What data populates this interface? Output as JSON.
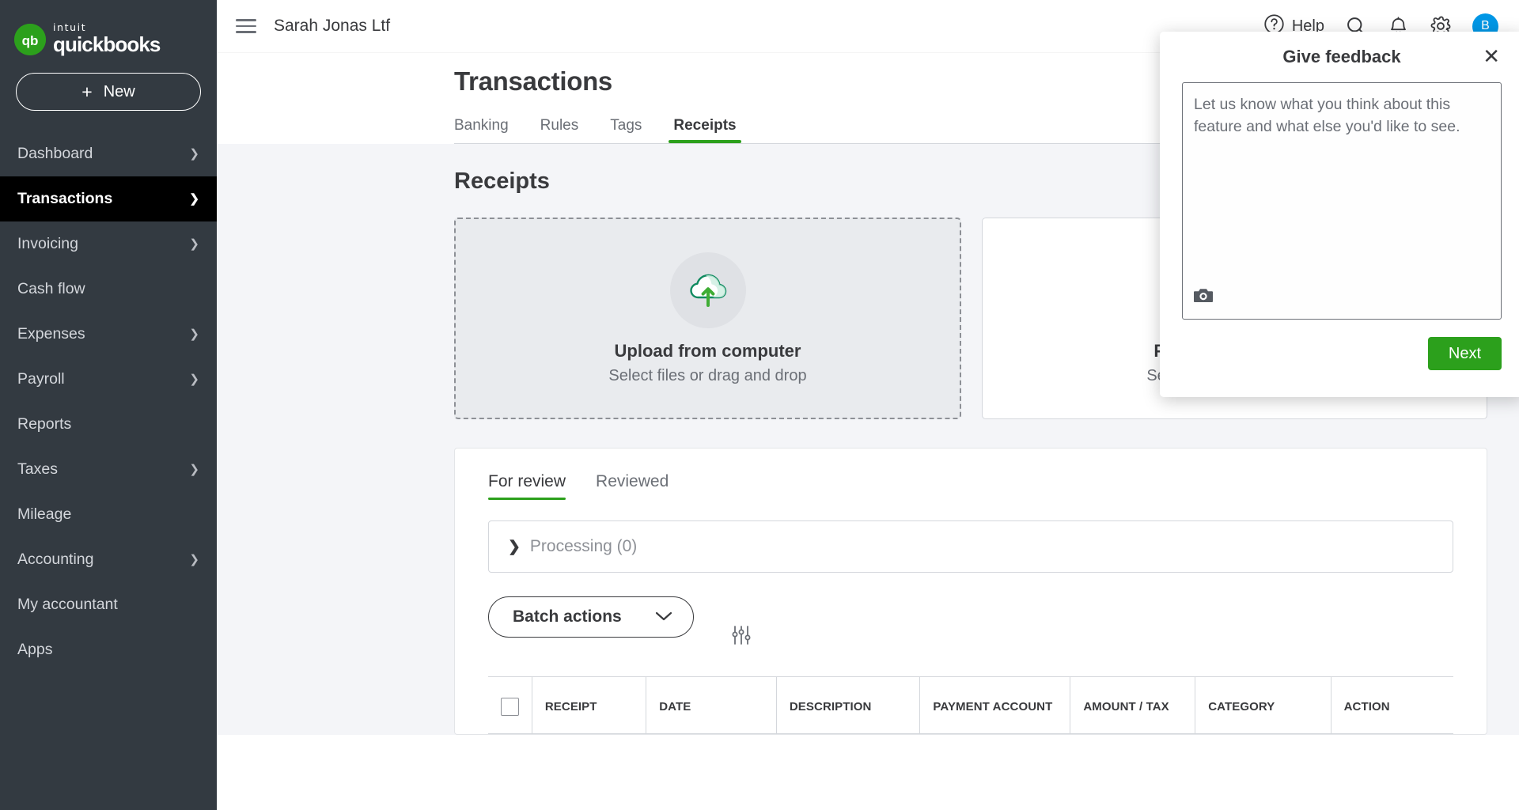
{
  "brand": {
    "intuit": "intuit",
    "product": "quickbooks",
    "mark_letters": "qb"
  },
  "sidebar": {
    "new_button": {
      "plus": "+",
      "label": "New"
    },
    "items": [
      {
        "label": "Dashboard",
        "has_chevron": true,
        "active": false
      },
      {
        "label": "Transactions",
        "has_chevron": true,
        "active": true
      },
      {
        "label": "Invoicing",
        "has_chevron": true,
        "active": false
      },
      {
        "label": "Cash flow",
        "has_chevron": false,
        "active": false
      },
      {
        "label": "Expenses",
        "has_chevron": true,
        "active": false
      },
      {
        "label": "Payroll",
        "has_chevron": true,
        "active": false
      },
      {
        "label": "Reports",
        "has_chevron": false,
        "active": false
      },
      {
        "label": "Taxes",
        "has_chevron": true,
        "active": false
      },
      {
        "label": "Mileage",
        "has_chevron": false,
        "active": false
      },
      {
        "label": "Accounting",
        "has_chevron": true,
        "active": false
      },
      {
        "label": "My accountant",
        "has_chevron": false,
        "active": false
      },
      {
        "label": "Apps",
        "has_chevron": false,
        "active": false
      }
    ]
  },
  "topbar": {
    "company": "Sarah Jonas Ltf",
    "help_label": "Help",
    "icons": [
      "hamburger-icon",
      "help-icon",
      "search-icon",
      "bell-icon",
      "gear-icon"
    ],
    "avatar_initial": "B",
    "avatar_color": "#0097e6"
  },
  "page": {
    "title": "Transactions",
    "tabs": [
      {
        "label": "Banking",
        "active": false
      },
      {
        "label": "Rules",
        "active": false
      },
      {
        "label": "Tags",
        "active": false
      },
      {
        "label": "Receipts",
        "active": true
      }
    ]
  },
  "receipts": {
    "heading": "Receipts",
    "give_feedback_label": "Give feedback",
    "upload_card": {
      "title": "Upload from computer",
      "subtitle": "Select files or drag and drop",
      "icon": "cloud-upload-icon"
    },
    "email_card": {
      "title": "Forward from email",
      "subtitle": "Set up receipt forwarding",
      "icon": "envelope-icon"
    },
    "sub_tabs": [
      {
        "label": "For review",
        "active": true
      },
      {
        "label": "Reviewed",
        "active": false
      }
    ],
    "processing_label": "Processing (0)",
    "batch_actions_label": "Batch actions",
    "filter_icon": "sliders-icon",
    "table_columns": [
      "RECEIPT",
      "DATE",
      "DESCRIPTION",
      "PAYMENT ACCOUNT",
      "AMOUNT / TAX",
      "CATEGORY",
      "ACTION"
    ]
  },
  "feedback_modal": {
    "title": "Give feedback",
    "close_icon": "close-icon",
    "textarea_placeholder": "Let us know what you think about this feature and what else you'd like to see.",
    "camera_icon": "camera-icon",
    "next_label": "Next"
  },
  "colors": {
    "brand_green": "#2ca01c",
    "sidebar_bg": "#333a41",
    "active_nav_bg": "#000000",
    "accent_blue": "#0097e6",
    "page_bg": "#f4f5f8"
  }
}
